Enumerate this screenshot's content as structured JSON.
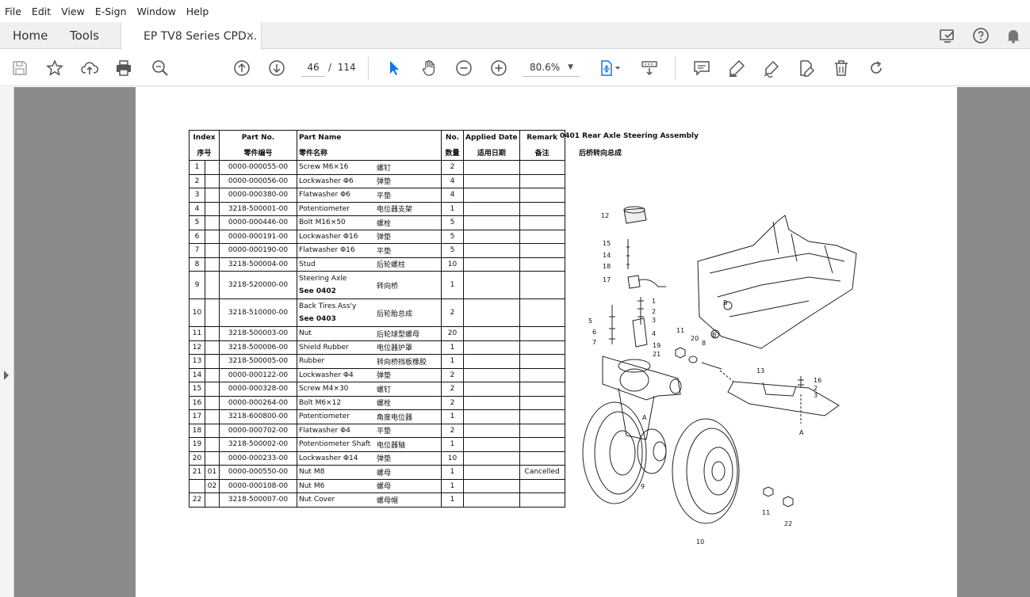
{
  "menu": [
    "File",
    "Edit",
    "View",
    "E-Sign",
    "Window",
    "Help"
  ],
  "tabs": {
    "home": "Home",
    "tools": "Tools",
    "document": "EP TV8 Series CPD...",
    "close": "×"
  },
  "toolbar": {
    "page_current": "46",
    "page_sep": "/",
    "page_total": "114",
    "zoom": "80.6%"
  },
  "document": {
    "title_en": "0401 Rear Axle Steering Assembly",
    "title_cn": "后桥转向总成",
    "headers": {
      "index_en": "Index",
      "index_cn": "序号",
      "partno_en": "Part No.",
      "partno_cn": "零件编号",
      "partname_en": "Part Name",
      "partname_cn": "零件名称",
      "no_en": "No.",
      "no_cn": "数量",
      "date_en": "Applied Date",
      "date_cn": "适用日期",
      "remark_en": "Remark",
      "remark_cn": "备注"
    },
    "rows": [
      {
        "idx": "1",
        "sub": "",
        "part": "0000-000055-00",
        "name": "Screw M6×16",
        "cn": "螺钉",
        "qty": "2",
        "remark": "",
        "see": ""
      },
      {
        "idx": "2",
        "sub": "",
        "part": "0000-000056-00",
        "name": "Lockwasher Φ6",
        "cn": "弹垫",
        "qty": "4",
        "remark": "",
        "see": ""
      },
      {
        "idx": "3",
        "sub": "",
        "part": "0000-000380-00",
        "name": "Flatwasher Φ6",
        "cn": "平垫",
        "qty": "4",
        "remark": "",
        "see": ""
      },
      {
        "idx": "4",
        "sub": "",
        "part": "3218-500001-00",
        "name": "Potentiometer",
        "cn": "电位器支架",
        "qty": "1",
        "remark": "",
        "see": ""
      },
      {
        "idx": "5",
        "sub": "",
        "part": "0000-000446-00",
        "name": "Bolt M16×50",
        "cn": "螺栓",
        "qty": "5",
        "remark": "",
        "see": ""
      },
      {
        "idx": "6",
        "sub": "",
        "part": "0000-000191-00",
        "name": "Lockwasher Φ16",
        "cn": "弹垫",
        "qty": "5",
        "remark": "",
        "see": ""
      },
      {
        "idx": "7",
        "sub": "",
        "part": "0000-000190-00",
        "name": "Flatwasher Φ16",
        "cn": "平垫",
        "qty": "5",
        "remark": "",
        "see": ""
      },
      {
        "idx": "8",
        "sub": "",
        "part": "3218-500004-00",
        "name": "Stud",
        "cn": "后轮螺柱",
        "qty": "10",
        "remark": "",
        "see": ""
      },
      {
        "idx": "9",
        "sub": "",
        "part": "3218-520000-00",
        "name": "Steering Axle",
        "cn": "转向桥",
        "qty": "1",
        "remark": "",
        "see": "See 0402"
      },
      {
        "idx": "10",
        "sub": "",
        "part": "3218-510000-00",
        "name": "Back Tires Ass'y",
        "cn": "后轮胎总成",
        "qty": "2",
        "remark": "",
        "see": "See 0403"
      },
      {
        "idx": "11",
        "sub": "",
        "part": "3218-500003-00",
        "name": "Nut",
        "cn": "后轮球型螺母",
        "qty": "20",
        "remark": "",
        "see": ""
      },
      {
        "idx": "12",
        "sub": "",
        "part": "3218-500006-00",
        "name": "Shield Rubber",
        "cn": "电位器护罩",
        "qty": "1",
        "remark": "",
        "see": ""
      },
      {
        "idx": "13",
        "sub": "",
        "part": "3218-500005-00",
        "name": "Rubber",
        "cn": "转向桥挡板橡胶",
        "qty": "1",
        "remark": "",
        "see": ""
      },
      {
        "idx": "14",
        "sub": "",
        "part": "0000-000122-00",
        "name": "Lockwasher Φ4",
        "cn": "弹垫",
        "qty": "2",
        "remark": "",
        "see": ""
      },
      {
        "idx": "15",
        "sub": "",
        "part": "0000-000328-00",
        "name": "Screw M4×30",
        "cn": "螺钉",
        "qty": "2",
        "remark": "",
        "see": ""
      },
      {
        "idx": "16",
        "sub": "",
        "part": "0000-000264-00",
        "name": "Bolt M6×12",
        "cn": "螺栓",
        "qty": "2",
        "remark": "",
        "see": ""
      },
      {
        "idx": "17",
        "sub": "",
        "part": "3218-600800-00",
        "name": "Potentiometer",
        "cn": "角度电位器",
        "qty": "1",
        "remark": "",
        "see": ""
      },
      {
        "idx": "18",
        "sub": "",
        "part": "0000-000702-00",
        "name": "Flatwasher Φ4",
        "cn": "平垫",
        "qty": "2",
        "remark": "",
        "see": ""
      },
      {
        "idx": "19",
        "sub": "",
        "part": "3218-500002-00",
        "name": "Potentiometer Shaft",
        "cn": "电位器轴",
        "qty": "1",
        "remark": "",
        "see": ""
      },
      {
        "idx": "20",
        "sub": "",
        "part": "0000-000233-00",
        "name": "Lockwasher Φ14",
        "cn": "弹垫",
        "qty": "10",
        "remark": "",
        "see": ""
      },
      {
        "idx": "21",
        "sub": "01",
        "part": "0000-000550-00",
        "name": "Nut M8",
        "cn": "螺母",
        "qty": "1",
        "remark": "Cancelled",
        "see": ""
      },
      {
        "idx": "",
        "sub": "02",
        "part": "0000-000108-00",
        "name": "Nut M6",
        "cn": "螺母",
        "qty": "1",
        "remark": "",
        "see": ""
      },
      {
        "idx": "22",
        "sub": "",
        "part": "3218-500007-00",
        "name": "Nut Cover",
        "cn": "螺母帽",
        "qty": "1",
        "remark": "",
        "see": ""
      }
    ],
    "diagram_labels": [
      "12",
      "15",
      "14",
      "18",
      "17",
      "1",
      "2",
      "3",
      "5",
      "6",
      "7",
      "4",
      "19",
      "21",
      "11",
      "20",
      "8",
      "13",
      "16",
      "2",
      "3",
      "A",
      "B",
      "A",
      "B",
      "9",
      "11",
      "22",
      "10"
    ]
  }
}
